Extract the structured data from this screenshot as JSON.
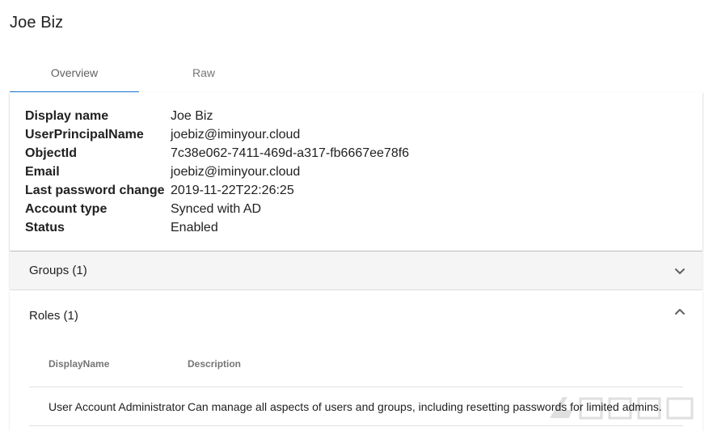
{
  "page": {
    "title": "Joe Biz"
  },
  "tabs": [
    {
      "label": "Overview",
      "active": true
    },
    {
      "label": "Raw",
      "active": false
    }
  ],
  "details": [
    {
      "key": "Display name",
      "value": "Joe Biz"
    },
    {
      "key": "UserPrincipalName",
      "value": "joebiz@iminyour.cloud"
    },
    {
      "key": "ObjectId",
      "value": "7c38e062-7411-469d-a317-fb6667ee78f6"
    },
    {
      "key": "Email",
      "value": "joebiz@iminyour.cloud"
    },
    {
      "key": "Last password change",
      "value": "2019-11-22T22:26:25"
    },
    {
      "key": "Account type",
      "value": "Synced with AD"
    },
    {
      "key": "Status",
      "value": "Enabled"
    }
  ],
  "groups_panel": {
    "title": "Groups (1)",
    "expanded": false,
    "icon": "chevron-down-icon"
  },
  "roles_panel": {
    "title": "Roles (1)",
    "expanded": true,
    "icon": "chevron-up-icon",
    "columns": [
      "DisplayName",
      "Description"
    ],
    "rows": [
      {
        "display_name": "User Account Administrator",
        "description": "Can manage all aspects of users and groups, including resetting passwords for limited admins."
      }
    ]
  },
  "colors": {
    "accent": "#1976d2",
    "tab_text": "#757575",
    "divider": "#e0e0e0",
    "collapsed_panel_bg": "#f5f5f5"
  }
}
